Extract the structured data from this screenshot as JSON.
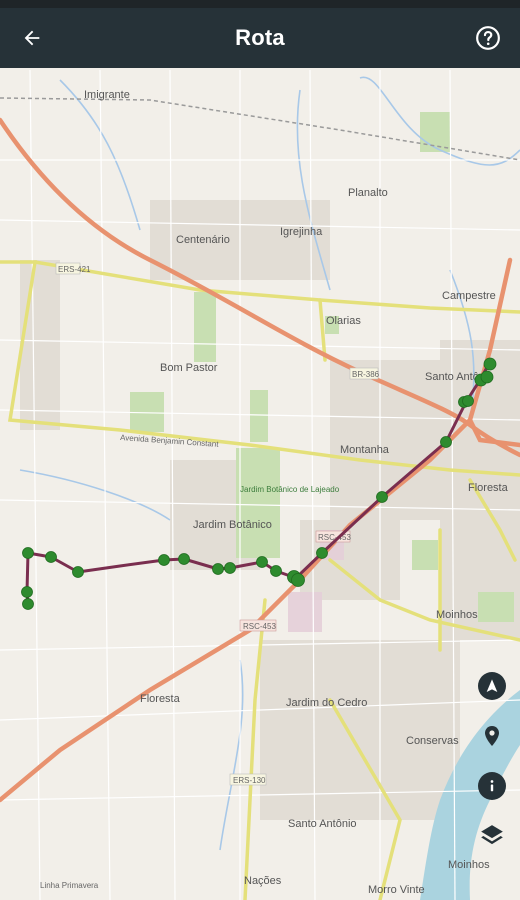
{
  "app_bar": {
    "title": "Rota",
    "back_icon": "arrow-back-icon",
    "help_icon": "help-circle-icon"
  },
  "map": {
    "places": {
      "imigrante": "Imigrante",
      "planalto": "Planalto",
      "centenario": "Centenário",
      "igrejinha": "Igrejinha",
      "campestre": "Campestre",
      "olarias": "Olarias",
      "bom_pastor": "Bom Pastor",
      "santo_antonio_ne": "Santo Antô",
      "montanha": "Montanha",
      "floresta_e": "Floresta",
      "jardim_botanico": "Jardim Botânico",
      "moinhos_e": "Moinhos",
      "floresta_sw": "Floresta",
      "jardim_do_cedro": "Jardim do Cedro",
      "conservas": "Conservas",
      "santo_antonio_s": "Santo Antônio",
      "moinhos_s": "Moinhos",
      "nacoes": "Nações",
      "morro_vinte": "Morro Vinte",
      "linha_primavera": "Linha Primavera"
    },
    "road_labels": {
      "ers421": "ERS-421",
      "br386": "BR-386",
      "rsc453_a": "RSC-453",
      "rsc453_b": "RSC-453",
      "ers130": "ERS-130",
      "benjamin": "Avenida Benjamin Constant",
      "jardim_park": "Jardim Botânico de Lajeado"
    },
    "route_color": "#7a2e4f",
    "stop_color": "#2e8b2e"
  },
  "controls": {
    "navigate_icon": "navigation-arrow-icon",
    "marker_icon": "location-pin-icon",
    "info_icon": "info-icon",
    "layers_icon": "layers-icon"
  }
}
